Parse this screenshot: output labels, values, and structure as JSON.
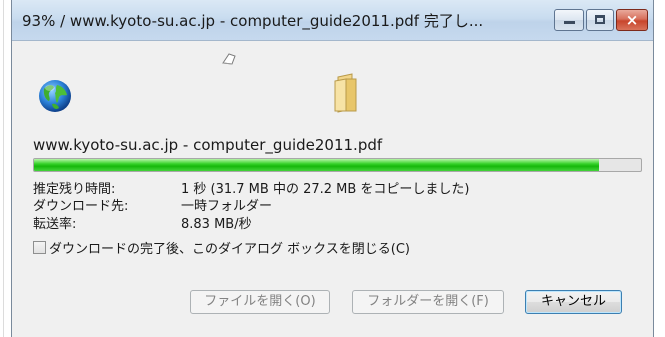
{
  "window": {
    "title": "93% / www.kyoto-su.ac.jp - computer_guide2011.pdf 完了し...",
    "controls": {
      "minimize": "minimize",
      "maximize": "maximize",
      "close": "×"
    }
  },
  "icons": {
    "source": "globe-icon",
    "transfer": "paper-icon",
    "destination": "folder-icon"
  },
  "transfer": {
    "filename": "www.kyoto-su.ac.jp - computer_guide2011.pdf",
    "progress_fraction": 0.93,
    "rows": [
      {
        "label": "推定残り時間:",
        "value": "1 秒 (31.7 MB 中の 27.2 MB をコピーしました)"
      },
      {
        "label": "ダウンロード先:",
        "value": "一時フォルダー"
      },
      {
        "label": "転送率:",
        "value": "8.83 MB/秒"
      }
    ]
  },
  "options": {
    "close_on_complete_label": "ダウンロードの完了後、このダイアログ ボックスを閉じる(C)",
    "close_on_complete_checked": false
  },
  "buttons": {
    "open_file": "ファイルを開く(O)",
    "open_folder": "フォルダーを開く(F)",
    "cancel": "キャンセル"
  },
  "colors": {
    "progress_fill": "#16b80c",
    "titlebar": "#c9dcef",
    "close_button": "#c8452c"
  }
}
